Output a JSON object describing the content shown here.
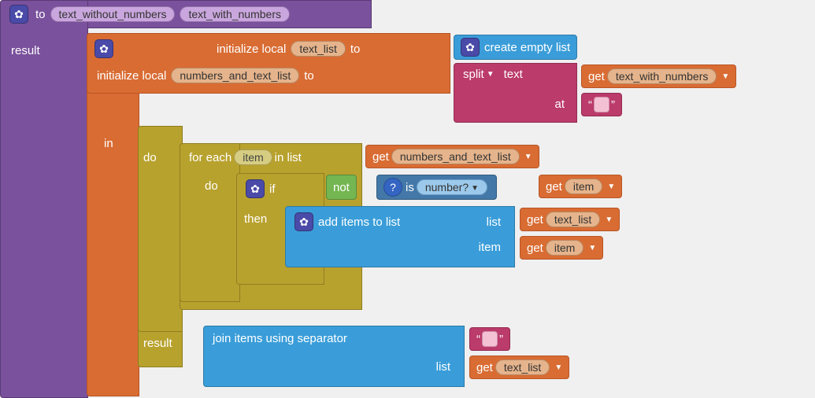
{
  "proc": {
    "to_label": "to",
    "name": "text_without_numbers",
    "param": "text_with_numbers",
    "result_label": "result"
  },
  "init": {
    "initialize_local": "initialize local",
    "var1": "text_list",
    "var2": "numbers_and_text_list",
    "to": "to",
    "in": "in",
    "result": "result"
  },
  "list": {
    "create_empty": "create empty list",
    "add_items": "add items to list",
    "list_label": "list",
    "item_label": "item",
    "join": "join items using separator"
  },
  "text": {
    "split": "split",
    "text_label": "text",
    "at_label": "at"
  },
  "get": {
    "label": "get",
    "text_with_numbers": "text_with_numbers",
    "numbers_and_text_list": "numbers_and_text_list",
    "item": "item",
    "text_list": "text_list"
  },
  "loop": {
    "do": "do",
    "for_each": "for each",
    "item": "item",
    "in_list": "in list"
  },
  "control": {
    "if": "if",
    "then": "then",
    "not": "not",
    "is": "is",
    "number_q": "number?"
  }
}
